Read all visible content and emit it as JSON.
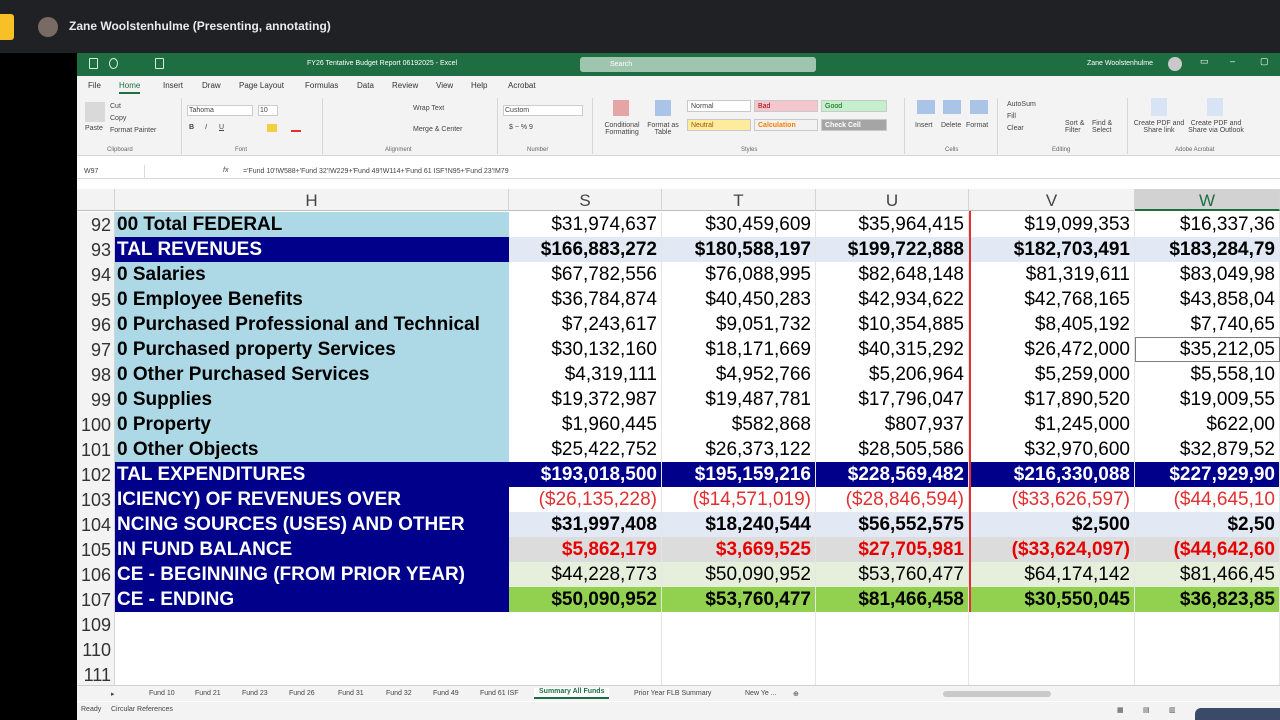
{
  "meet": {
    "presenter": "Zane Woolstenhulme (Presenting, annotating)"
  },
  "excel": {
    "title": "FY26 Tentative Budget Report 06192025  -  Excel",
    "search_placeholder": "Search",
    "user": "Zane Woolstenhulme",
    "tabs": [
      "File",
      "Home",
      "Insert",
      "Draw",
      "Page Layout",
      "Formulas",
      "Data",
      "Review",
      "View",
      "Help",
      "Acrobat"
    ],
    "ribbon": {
      "cut": "Cut",
      "copy": "Copy",
      "format_painter": "Format Painter",
      "paste": "Paste",
      "font_name": "Tahoma",
      "font_size": "10",
      "wrap_text": "Wrap Text",
      "merge_center": "Merge & Center",
      "number_format": "Custom",
      "conditional_formatting": "Conditional Formatting",
      "format_as_table": "Format as Table",
      "styles": {
        "normal": "Normal",
        "bad": "Bad",
        "good": "Good",
        "neutral": "Neutral",
        "calculation": "Calculation",
        "check_cell": "Check Cell"
      },
      "insert": "Insert",
      "delete": "Delete",
      "format": "Format",
      "autosum": "AutoSum",
      "fill": "Fill",
      "clear": "Clear",
      "sort_filter": "Sort & Filter",
      "find_select": "Find & Select",
      "create_pdf_link": "Create PDF and Share link",
      "create_pdf_outlook": "Create PDF and Share via Outlook",
      "groups": [
        "Clipboard",
        "Font",
        "Alignment",
        "Number",
        "Styles",
        "Cells",
        "Editing",
        "Adobe Acrobat"
      ]
    },
    "name_box": "W97",
    "formula": "='Fund 10'!W588+'Fund 32'!W229+'Fund 49'!W114+'Fund 61 ISF'!N95+'Fund 23'!M79",
    "columns": [
      "H",
      "S",
      "T",
      "U",
      "V",
      "W"
    ],
    "rows": [
      {
        "n": "92",
        "h": "00 Total FEDERAL",
        "s": "$31,974,637",
        "t": "$30,459,609",
        "u": "$35,964,415",
        "v": "$19,099,353",
        "w": "$16,337,36"
      },
      {
        "n": "93",
        "h": "TAL REVENUES",
        "s": "$166,883,272",
        "t": "$180,588,197",
        "u": "$199,722,888",
        "v": "$182,703,491",
        "w": "$183,284,79"
      },
      {
        "n": "94",
        "h": "0 Salaries",
        "s": "$67,782,556",
        "t": "$76,088,995",
        "u": "$82,648,148",
        "v": "$81,319,611",
        "w": "$83,049,98"
      },
      {
        "n": "95",
        "h": "0 Employee Benefits",
        "s": "$36,784,874",
        "t": "$40,450,283",
        "u": "$42,934,622",
        "v": "$42,768,165",
        "w": "$43,858,04"
      },
      {
        "n": "96",
        "h": "0 Purchased Professional and Technical",
        "s": "$7,243,617",
        "t": "$9,051,732",
        "u": "$10,354,885",
        "v": "$8,405,192",
        "w": "$7,740,65"
      },
      {
        "n": "97",
        "h": "0 Purchased property Services",
        "s": "$30,132,160",
        "t": "$18,171,669",
        "u": "$40,315,292",
        "v": "$26,472,000",
        "w": "$35,212,05"
      },
      {
        "n": "98",
        "h": "0 Other Purchased Services",
        "s": "$4,319,111",
        "t": "$4,952,766",
        "u": "$5,206,964",
        "v": "$5,259,000",
        "w": "$5,558,10"
      },
      {
        "n": "99",
        "h": "0 Supplies",
        "s": "$19,372,987",
        "t": "$19,487,781",
        "u": "$17,796,047",
        "v": "$17,890,520",
        "w": "$19,009,55"
      },
      {
        "n": "100",
        "h": "0 Property",
        "s": "$1,960,445",
        "t": "$582,868",
        "u": "$807,937",
        "v": "$1,245,000",
        "w": "$622,00"
      },
      {
        "n": "101",
        "h": "0 Other Objects",
        "s": "$25,422,752",
        "t": "$26,373,122",
        "u": "$28,505,586",
        "v": "$32,970,600",
        "w": "$32,879,52"
      },
      {
        "n": "102",
        "h": "TAL EXPENDITURES",
        "s": "$193,018,500",
        "t": "$195,159,216",
        "u": "$228,569,482",
        "v": "$216,330,088",
        "w": "$227,929,90"
      },
      {
        "n": "103",
        "h": "ICIENCY) OF REVENUES OVER",
        "s": "($26,135,228)",
        "t": "($14,571,019)",
        "u": "($28,846,594)",
        "v": "($33,626,597)",
        "w": "($44,645,10"
      },
      {
        "n": "104",
        "h": "NCING SOURCES (USES) AND OTHER",
        "s": "$31,997,408",
        "t": "$18,240,544",
        "u": "$56,552,575",
        "v": "$2,500",
        "w": "$2,50"
      },
      {
        "n": "105",
        "h": " IN FUND BALANCE",
        "s": "$5,862,179",
        "t": "$3,669,525",
        "u": "$27,705,981",
        "v": "($33,624,097)",
        "w": "($44,642,60"
      },
      {
        "n": "106",
        "h": "CE - BEGINNING (FROM PRIOR YEAR)",
        "s": "$44,228,773",
        "t": "$50,090,952",
        "u": "$53,760,477",
        "v": "$64,174,142",
        "w": "$81,466,45"
      },
      {
        "n": "107",
        "h": "CE - ENDING",
        "s": "$50,090,952",
        "t": "$53,760,477",
        "u": "$81,466,458",
        "v": "$30,550,045",
        "w": "$36,823,85"
      },
      {
        "n": "109",
        "h": "",
        "s": "",
        "t": "",
        "u": "",
        "v": "",
        "w": ""
      },
      {
        "n": "110",
        "h": "",
        "s": "",
        "t": "",
        "u": "",
        "v": "",
        "w": ""
      },
      {
        "n": "111",
        "h": "",
        "s": "",
        "t": "",
        "u": "",
        "v": "",
        "w": ""
      }
    ],
    "sheet_tabs": [
      "Fund 10",
      "Fund 21",
      "Fund 23",
      "Fund 26",
      "Fund 31",
      "Fund 32",
      "Fund 49",
      "Fund 61 ISF",
      "Summary All Funds",
      "Prior Year FLB Summary",
      "New Ye ..."
    ],
    "active_sheet": "Summary All Funds",
    "status_ready": "Ready",
    "status_circular": "Circular References"
  }
}
